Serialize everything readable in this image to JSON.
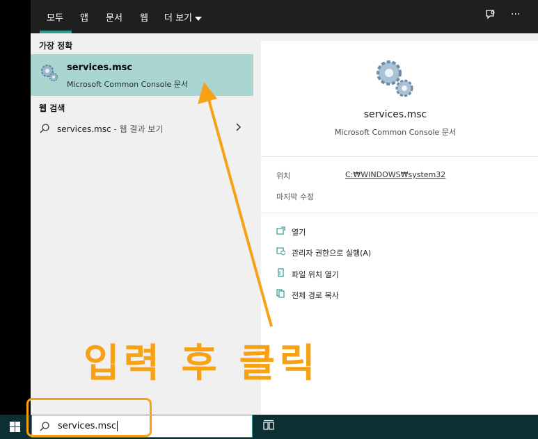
{
  "tabs": [
    {
      "label": "모두"
    },
    {
      "label": "앱"
    },
    {
      "label": "문서"
    },
    {
      "label": "웹"
    },
    {
      "label": "더 보기"
    }
  ],
  "top_icons": {
    "feedback": "feedback-icon",
    "more": "···"
  },
  "best_match": {
    "section_label": "가장 정확",
    "title": "services.msc",
    "subtitle": "Microsoft Common Console 문서"
  },
  "web_search": {
    "section_label": "웹 검색",
    "query": "services.msc",
    "suffix": " - 웹 결과 보기"
  },
  "detail": {
    "title": "services.msc",
    "subtitle": "Microsoft Common Console 문서",
    "location_label": "위치",
    "location_value": "C:₩WINDOWS₩system32",
    "modified_label": "마지막 수정",
    "actions": [
      {
        "icon": "open-icon",
        "label": "열기"
      },
      {
        "icon": "run-as-admin-icon",
        "label": "관리자 권한으로 실행(A)"
      },
      {
        "icon": "file-location-icon",
        "label": "파일 위치 열기"
      },
      {
        "icon": "copy-path-icon",
        "label": "전체 경로 복사"
      }
    ]
  },
  "annotation": {
    "text": "입력 후 클릭",
    "color": "#f7a214"
  },
  "taskbar": {
    "search_value": "services.msc"
  },
  "colors": {
    "accent": "#2f9d8f",
    "selected": "#a9d6d1",
    "annotation": "#f7a214"
  }
}
